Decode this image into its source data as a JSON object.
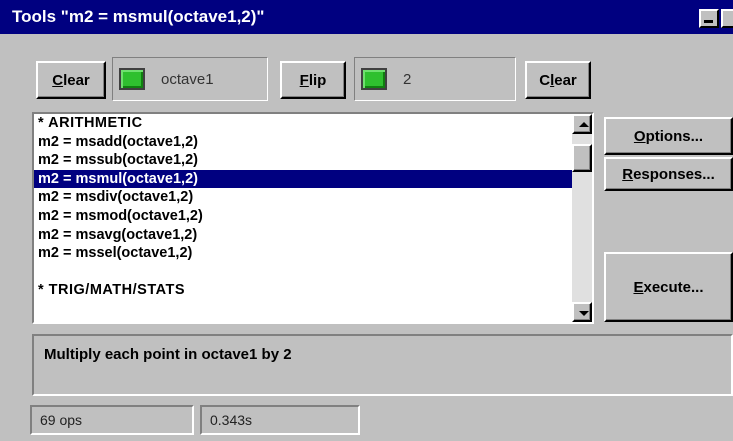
{
  "window": {
    "title": "Tools \"m2 = msmul(octave1,2)\""
  },
  "controls": {
    "clear_left": {
      "accel": "C",
      "rest": "lear"
    },
    "flip": {
      "accel": "F",
      "rest": "lip"
    },
    "clear_right": {
      "pre": "C",
      "accel": "l",
      "rest": "ear"
    },
    "operand1": {
      "value": "octave1",
      "indicator_color": "#2fc02f"
    },
    "operand2": {
      "value": "2",
      "indicator_color": "#2fc02f"
    }
  },
  "list": {
    "items": [
      "* ARITHMETIC",
      "m2 = msadd(octave1,2)",
      "m2 = mssub(octave1,2)",
      "m2 = msmul(octave1,2)",
      "m2 = msdiv(octave1,2)",
      "m2 = msmod(octave1,2)",
      "m2 = msavg(octave1,2)",
      "m2 = mssel(octave1,2)",
      "",
      "* TRIG/MATH/STATS"
    ],
    "selected_index": 3
  },
  "side_buttons": {
    "options": {
      "accel": "O",
      "rest": "ptions..."
    },
    "responses": {
      "accel": "R",
      "rest": "esponses..."
    },
    "execute": {
      "accel": "E",
      "rest": "xecute..."
    }
  },
  "description": "Multiply each point in octave1 by 2",
  "status": {
    "ops": "69 ops",
    "time": "0.343s"
  },
  "colors": {
    "titlebar": "#000080",
    "selection": "#000080",
    "face": "#c0c0c0"
  }
}
